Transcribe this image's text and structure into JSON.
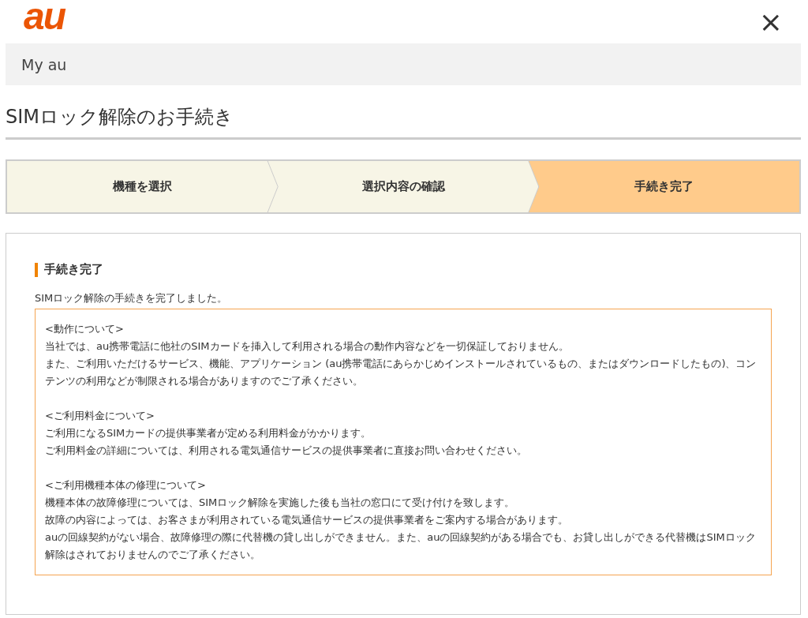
{
  "header": {
    "logo": "au",
    "close": "×"
  },
  "service_bar": {
    "label": "My au"
  },
  "page_title": "SIMロック解除のお手続き",
  "steps": [
    {
      "label": "機種を選択",
      "selected": false
    },
    {
      "label": "選択内容の確認",
      "selected": false
    },
    {
      "label": "手続き完了",
      "selected": true
    }
  ],
  "panel": {
    "heading": "手続き完了",
    "message": "SIMロック解除の手続きを完了しました。",
    "notice_sections": [
      {
        "heading": "<動作について>",
        "lines": [
          "当社では、au携帯電話に他社のSIMカードを挿入して利用される場合の動作内容などを一切保証しておりません。",
          "また、ご利用いただけるサービス、機能、アプリケーション (au携帯電話にあらかじめインストールされているもの、またはダウンロードしたもの)、コンテンツの利用などが制限される場合がありますのでご了承ください。"
        ]
      },
      {
        "heading": "<ご利用料金について>",
        "lines": [
          "ご利用になるSIMカードの提供事業者が定める利用料金がかかります。",
          "ご利用料金の詳細については、利用される電気通信サービスの提供事業者に直接お問い合わせください。"
        ]
      },
      {
        "heading": "<ご利用機種本体の修理について>",
        "lines": [
          "機種本体の故障修理については、SIMロック解除を実施した後も当社の窓口にて受け付けを致します。",
          "故障の内容によっては、お客さまが利用されている電気通信サービスの提供事業者をご案内する場合があります。",
          "auの回線契約がない場合、故障修理の際に代替機の貸し出しができません。また、auの回線契約がある場合でも、お貸し出しができる代替機はSIMロック解除はされておりませんのでご了承ください。"
        ]
      }
    ]
  }
}
